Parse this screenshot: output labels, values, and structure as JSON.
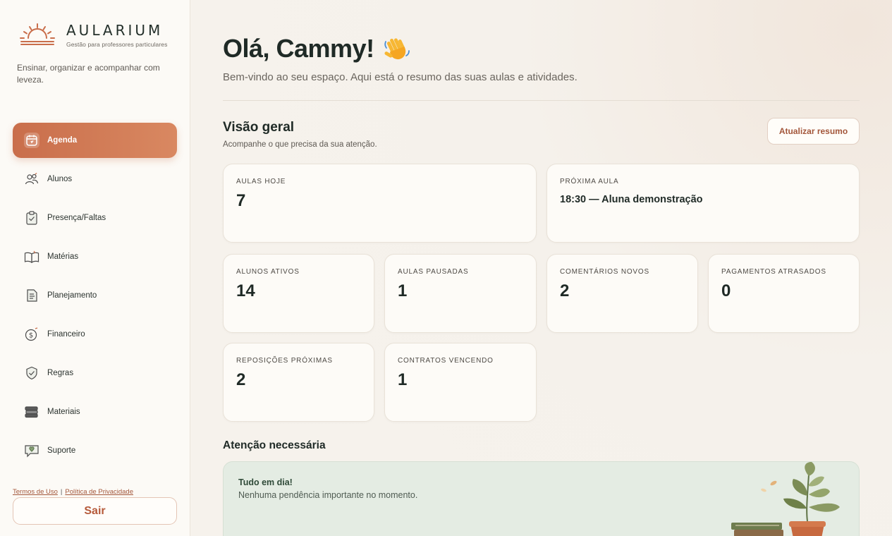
{
  "brand": {
    "name": "AULARIUM",
    "subtitle": "Gestão para professores particulares",
    "tagline": "Ensinar, organizar e acompanhar com leveza."
  },
  "sidebar": {
    "items": [
      {
        "label": "Agenda",
        "icon": "calendar-icon",
        "active": true
      },
      {
        "label": "Alunos",
        "icon": "users-icon"
      },
      {
        "label": "Presença/Faltas",
        "icon": "clipboard-check-icon"
      },
      {
        "label": "Matérias",
        "icon": "open-book-icon"
      },
      {
        "label": "Planejamento",
        "icon": "document-icon"
      },
      {
        "label": "Financeiro",
        "icon": "money-icon"
      },
      {
        "label": "Regras",
        "icon": "shield-check-icon"
      },
      {
        "label": "Materiais",
        "icon": "books-stack-icon"
      },
      {
        "label": "Suporte",
        "icon": "support-chat-icon"
      }
    ],
    "terms": "Termos de Uso",
    "separator": "|",
    "privacy": "Política de Privacidade",
    "logout": "Sair"
  },
  "header": {
    "greeting": "Olá, Cammy!",
    "welcome": "Bem-vindo ao seu espaço. Aqui está o resumo das suas aulas e atividades."
  },
  "overview": {
    "title": "Visão geral",
    "subtitle": "Acompanhe o que precisa da sua atenção.",
    "refresh_label": "Atualizar resumo",
    "cards": {
      "aulas_hoje": {
        "label": "AULAS HOJE",
        "value": "7"
      },
      "proxima_aula": {
        "label": "PRÓXIMA AULA",
        "value": "18:30 — Aluna demonstração"
      },
      "alunos_ativos": {
        "label": "ALUNOS ATIVOS",
        "value": "14"
      },
      "aulas_pausadas": {
        "label": "AULAS PAUSADAS",
        "value": "1"
      },
      "comentarios_novos": {
        "label": "COMENTÁRIOS NOVOS",
        "value": "2"
      },
      "pagamentos_atrasados": {
        "label": "PAGAMENTOS ATRASADOS",
        "value": "0"
      },
      "reposicoes_proximas": {
        "label": "REPOSIÇÕES PRÓXIMAS",
        "value": "2"
      },
      "contratos_vencendo": {
        "label": "CONTRATOS VENCENDO",
        "value": "1"
      }
    }
  },
  "attention": {
    "title": "Atenção necessária",
    "status_title": "Tudo em dia!",
    "status_text": "Nenhuma pendência importante no momento."
  },
  "colors": {
    "accent": "#c96e4b",
    "accent_light": "#d98861",
    "success_bg": "#e4ece3",
    "sidebar_bg": "#fcfaf6"
  }
}
